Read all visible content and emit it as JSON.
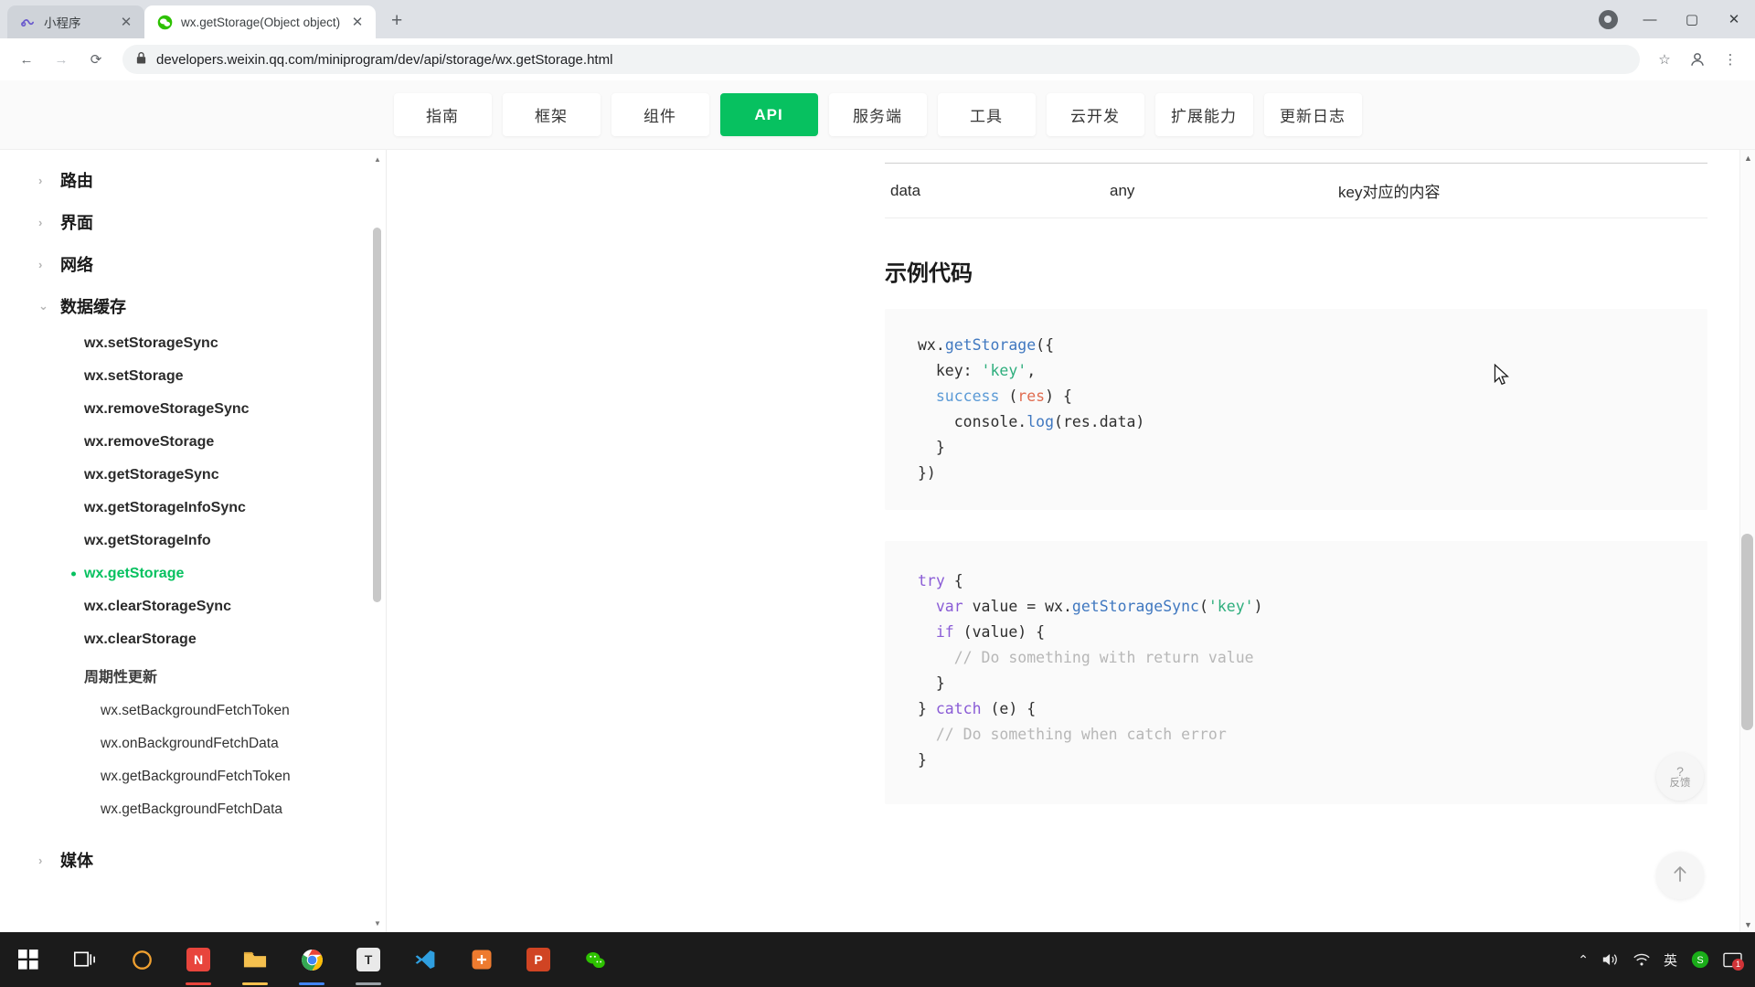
{
  "browser": {
    "tabs": [
      {
        "title": "小程序",
        "icon": "miniprogram-icon",
        "active": false,
        "close_label": "✕"
      },
      {
        "title": "wx.getStorage(Object object)",
        "icon": "wechat-icon",
        "active": true,
        "close_label": "✕"
      }
    ],
    "newtab_label": "+",
    "window_controls": {
      "record": "record-dot",
      "minimize": "—",
      "maximize": "▢",
      "close": "✕"
    },
    "toolbar": {
      "back": "←",
      "forward": "→",
      "reload": "⟳",
      "lock_icon": "lock-icon",
      "url": "developers.weixin.qq.com/miniprogram/dev/api/storage/wx.getStorage.html",
      "bookmark": "☆",
      "profile": "profile-avatar",
      "menu": "⋮"
    }
  },
  "topnav": {
    "items": [
      {
        "label": "指南",
        "active": false
      },
      {
        "label": "框架",
        "active": false
      },
      {
        "label": "组件",
        "active": false
      },
      {
        "label": "API",
        "active": true
      },
      {
        "label": "服务端",
        "active": false
      },
      {
        "label": "工具",
        "active": false
      },
      {
        "label": "云开发",
        "active": false
      },
      {
        "label": "扩展能力",
        "active": false
      },
      {
        "label": "更新日志",
        "active": false
      }
    ],
    "accent_color": "#07c160"
  },
  "sidebar": {
    "groups": [
      {
        "label": "路由",
        "caret": "›",
        "expanded": false
      },
      {
        "label": "界面",
        "caret": "›",
        "expanded": false
      },
      {
        "label": "网络",
        "caret": "›",
        "expanded": false
      },
      {
        "label": "数据缓存",
        "caret": "⌄",
        "expanded": true
      }
    ],
    "items": [
      "wx.setStorageSync",
      "wx.setStorage",
      "wx.removeStorageSync",
      "wx.removeStorage",
      "wx.getStorageSync",
      "wx.getStorageInfoSync",
      "wx.getStorageInfo"
    ],
    "current_item": "wx.getStorage",
    "items_after": [
      "wx.clearStorageSync",
      "wx.clearStorage"
    ],
    "subgroup": {
      "label": "周期性更新",
      "leaves": [
        "wx.setBackgroundFetchToken",
        "wx.onBackgroundFetchData",
        "wx.getBackgroundFetchToken",
        "wx.getBackgroundFetchData"
      ]
    },
    "last_group": {
      "label": "媒体",
      "caret": "›"
    },
    "scroll_up": "▲",
    "scroll_down": "▼",
    "active_color": "#07c160"
  },
  "main": {
    "table": {
      "rows": [
        {
          "name": "data",
          "type": "any",
          "desc": "key对应的内容"
        }
      ]
    },
    "section_title": "示例代码",
    "code_blocks": [
      {
        "name": "async-example",
        "lines": [
          [
            {
              "t": "wx.",
              "c": "plain"
            },
            {
              "t": "getStorage",
              "c": "fn"
            },
            {
              "t": "({",
              "c": "plain"
            }
          ],
          [
            {
              "t": "  key: ",
              "c": "plain"
            },
            {
              "t": "'key'",
              "c": "str"
            },
            {
              "t": ",",
              "c": "plain"
            }
          ],
          [
            {
              "t": "  ",
              "c": "plain"
            },
            {
              "t": "success",
              "c": "prop"
            },
            {
              "t": " (",
              "c": "plain"
            },
            {
              "t": "res",
              "c": "arg"
            },
            {
              "t": ") {",
              "c": "plain"
            }
          ],
          [
            {
              "t": "    console.",
              "c": "plain"
            },
            {
              "t": "log",
              "c": "fn"
            },
            {
              "t": "(res.data)",
              "c": "plain"
            }
          ],
          [
            {
              "t": "  }",
              "c": "plain"
            }
          ],
          [
            {
              "t": "})",
              "c": "plain"
            }
          ]
        ]
      },
      {
        "name": "sync-try-catch-example",
        "lines": [
          [
            {
              "t": "try",
              "c": "kw"
            },
            {
              "t": " {",
              "c": "plain"
            }
          ],
          [
            {
              "t": "  ",
              "c": "plain"
            },
            {
              "t": "var",
              "c": "kw"
            },
            {
              "t": " value = wx.",
              "c": "plain"
            },
            {
              "t": "getStorageSync",
              "c": "fn"
            },
            {
              "t": "(",
              "c": "plain"
            },
            {
              "t": "'key'",
              "c": "str"
            },
            {
              "t": ")",
              "c": "plain"
            }
          ],
          [
            {
              "t": "  ",
              "c": "plain"
            },
            {
              "t": "if",
              "c": "kw"
            },
            {
              "t": " (value) {",
              "c": "plain"
            }
          ],
          [
            {
              "t": "    ",
              "c": "plain"
            },
            {
              "t": "// Do something with return value",
              "c": "com"
            }
          ],
          [
            {
              "t": "  }",
              "c": "plain"
            }
          ],
          [
            {
              "t": "} ",
              "c": "plain"
            },
            {
              "t": "catch",
              "c": "kw"
            },
            {
              "t": " (e) {",
              "c": "plain"
            }
          ],
          [
            {
              "t": "  ",
              "c": "plain"
            },
            {
              "t": "// Do something when catch error",
              "c": "com"
            }
          ],
          [
            {
              "t": "}",
              "c": "plain"
            }
          ]
        ]
      }
    ],
    "feedback_button": {
      "mark": "?",
      "label": "反馈"
    },
    "back_to_top": "↑"
  },
  "taskbar": {
    "icons": [
      {
        "name": "start-windows-icon",
        "glyph": "⊞",
        "color": "#ffffff",
        "underline": ""
      },
      {
        "name": "task-view-icon",
        "glyph": "❏",
        "color": "#ffffff",
        "underline": ""
      },
      {
        "name": "browser-circle-icon",
        "glyph": "◯",
        "color": "#f0a030",
        "underline": ""
      },
      {
        "name": "notepad-red-icon",
        "glyph": "N",
        "color": "#e8453c",
        "underline": "#e8453c"
      },
      {
        "name": "file-explorer-icon",
        "glyph": "🗀",
        "color": "#f5c04e",
        "underline": "#f5c04e"
      },
      {
        "name": "chrome-icon",
        "glyph": "◉",
        "color": "#4285f4",
        "underline": "#4285f4"
      },
      {
        "name": "typora-icon",
        "glyph": "T",
        "color": "#d8d8d8",
        "underline": "#9aa0a6"
      },
      {
        "name": "vscode-icon",
        "glyph": "⧨",
        "color": "#2f9fe0",
        "underline": ""
      },
      {
        "name": "xmind-icon",
        "glyph": "✺",
        "color": "#ee7b2f",
        "underline": ""
      },
      {
        "name": "powerpoint-icon",
        "glyph": "P",
        "color": "#d04423",
        "underline": ""
      },
      {
        "name": "wechat-icon",
        "glyph": "💬",
        "color": "#2dc100",
        "underline": ""
      }
    ],
    "tray": {
      "chevron": "⌃",
      "volume": "volume-icon",
      "network": "network-icon",
      "ime_lang": "英",
      "ime_app": "S",
      "notification": "notification-icon",
      "badge": "1"
    }
  }
}
